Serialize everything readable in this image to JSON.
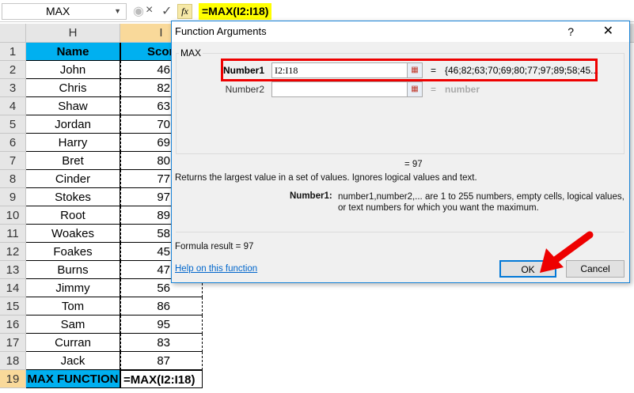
{
  "formula_bar": {
    "name_box": "MAX",
    "formula": "=MAX(I2:I18)",
    "cancel_icon": "×",
    "enter_icon": "✓",
    "fx_label": "fx"
  },
  "columns": [
    "H",
    "I"
  ],
  "rows": [
    {
      "n": "1",
      "name": "Name",
      "score": "Score"
    },
    {
      "n": "2",
      "name": "John",
      "score": "46"
    },
    {
      "n": "3",
      "name": "Chris",
      "score": "82"
    },
    {
      "n": "4",
      "name": "Shaw",
      "score": "63"
    },
    {
      "n": "5",
      "name": "Jordan",
      "score": "70"
    },
    {
      "n": "6",
      "name": "Harry",
      "score": "69"
    },
    {
      "n": "7",
      "name": "Bret",
      "score": "80"
    },
    {
      "n": "8",
      "name": "Cinder",
      "score": "77"
    },
    {
      "n": "9",
      "name": "Stokes",
      "score": "97"
    },
    {
      "n": "10",
      "name": "Root",
      "score": "89"
    },
    {
      "n": "11",
      "name": "Woakes",
      "score": "58"
    },
    {
      "n": "12",
      "name": "Foakes",
      "score": "45"
    },
    {
      "n": "13",
      "name": "Burns",
      "score": "47"
    },
    {
      "n": "14",
      "name": "Jimmy",
      "score": "56"
    },
    {
      "n": "15",
      "name": "Tom",
      "score": "86"
    },
    {
      "n": "16",
      "name": "Sam",
      "score": "95"
    },
    {
      "n": "17",
      "name": "Curran",
      "score": "83"
    },
    {
      "n": "18",
      "name": "Jack",
      "score": "87"
    },
    {
      "n": "19",
      "name": "MAX FUNCTION",
      "score": "=MAX(I2:I18)"
    }
  ],
  "dialog": {
    "title": "Function Arguments",
    "help_glyph": "?",
    "close_glyph": "✕",
    "function_name": "MAX",
    "arg1_label": "Number1",
    "arg1_value": "I2:I18",
    "arg1_result": "{46;82;63;70;69;80;77;97;89;58;45...",
    "arg2_label": "Number2",
    "arg2_value": "",
    "arg2_result": "number",
    "equals": "=",
    "result_value": "= 97",
    "description": "Returns the largest value in a set of values. Ignores logical values and text.",
    "arg_help_label": "Number1:",
    "arg_help_text": "number1,number2,... are 1 to 255 numbers, empty cells, logical values, or text numbers for which you want the maximum.",
    "formula_result": "Formula result =   97",
    "help_link": "Help on this function",
    "ok": "OK",
    "cancel": "Cancel"
  },
  "colors": {
    "header_fill": "#00b0f0",
    "formula_highlight": "#ffff00",
    "annotation": "#e00000"
  }
}
